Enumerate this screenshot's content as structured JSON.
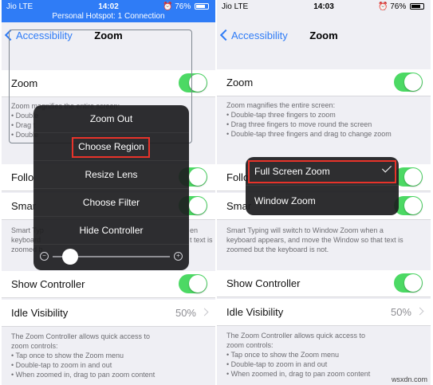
{
  "left": {
    "status": {
      "carrier": "Jio",
      "network": "LTE",
      "time": "14:02",
      "battery": "76%",
      "hotspot": "Personal Hotspot: 1 Connection"
    },
    "nav": {
      "back": "Accessibility",
      "title": "Zoom"
    },
    "zoom_row": {
      "label": "Zoom"
    },
    "zoom_note": [
      "Zoom magnifies the entire screen:",
      "• Double",
      "• Drag t",
      "• Double"
    ],
    "follow_row": {
      "label": "Follo"
    },
    "smart_row": {
      "label": "Smar"
    },
    "smart_note": [
      "Smart Typ",
      "keyboard",
      "zoomed b"
    ],
    "smart_note_right": [
      "en",
      "t text is"
    ],
    "controller_row": {
      "label": "Show Controller"
    },
    "idle_row": {
      "label": "Idle Visibility",
      "value": "50%"
    },
    "controller_note": [
      "The Zoom Controller allows quick access to",
      "zoom controls:",
      "• Tap once to show the Zoom menu",
      "• Double-tap to zoom in and out",
      "• When zoomed in, drag to pan zoom content"
    ],
    "menu": {
      "items": [
        "Zoom Out",
        "Choose Region",
        "Resize Lens",
        "Choose Filter",
        "Hide Controller"
      ],
      "slider_level": 0.15
    }
  },
  "right": {
    "status": {
      "carrier": "Jio",
      "network": "LTE",
      "time": "14:03",
      "battery": "76%"
    },
    "nav": {
      "back": "Accessibility",
      "title": "Zoom"
    },
    "zoom_row": {
      "label": "Zoom"
    },
    "zoom_note": [
      "Zoom magnifies the entire screen:",
      "• Double-tap three fingers to zoom",
      "• Drag three fingers to move round the screen",
      "• Double-tap three fingers and drag to change zoom"
    ],
    "follow_row": {
      "label": "Follo"
    },
    "smart_row": {
      "label": "Smar"
    },
    "smart_note": [
      "Smart Typing will switch to Window Zoom when a",
      "keyboard appears, and move the Window so that text is",
      "zoomed but the keyboard is not."
    ],
    "controller_row": {
      "label": "Show Controller"
    },
    "idle_row": {
      "label": "Idle Visibility",
      "value": "50%"
    },
    "controller_note": [
      "The Zoom Controller allows quick access to",
      "zoom controls:",
      "• Tap once to show the Zoom menu",
      "• Double-tap to zoom in and out",
      "• When zoomed in, drag to pan zoom content"
    ],
    "menu": {
      "items": [
        "Full Screen Zoom",
        "Window Zoom"
      ],
      "selected": "Full Screen Zoom"
    }
  },
  "watermark": "wsxdn.com",
  "colors": {
    "accent": "#2f7cf6",
    "toggle_on": "#4cd964",
    "highlight": "#e8332a",
    "menu_bg": "#1c1c1e"
  }
}
